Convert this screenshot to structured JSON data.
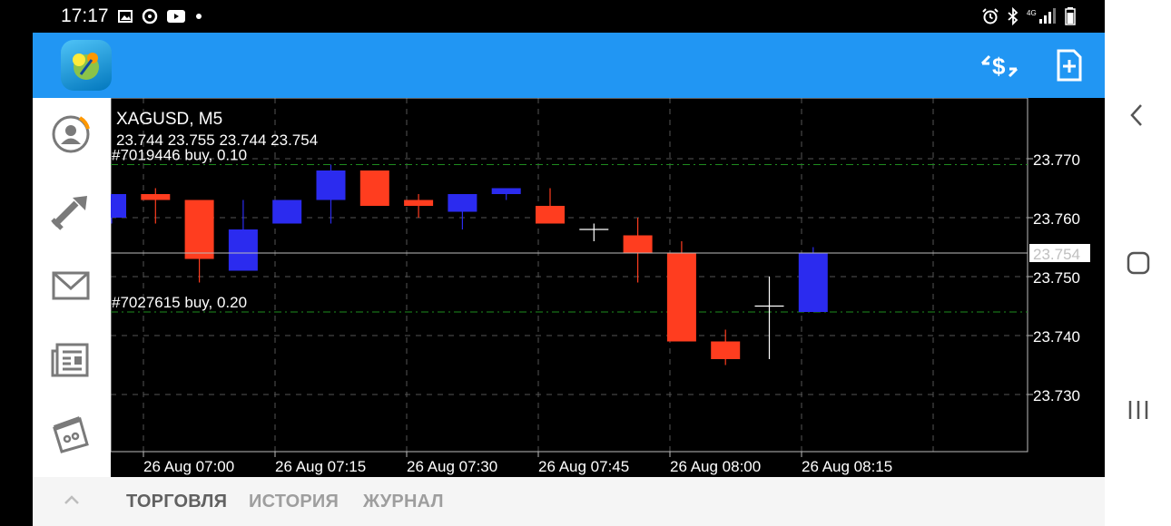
{
  "status": {
    "time": "17:17"
  },
  "chart": {
    "symbol": "XAGUSD, M5",
    "ohlc": "23.744 23.755 23.744 23.754",
    "orders": [
      {
        "label": "#7019446 buy, 0.10",
        "price": 23.769
      },
      {
        "label": "#7027615 buy, 0.20",
        "price": 23.744
      }
    ],
    "bid": 23.754,
    "bid_label": "23.754",
    "y_ticks": [
      "23.770",
      "23.760",
      "23.750",
      "23.740",
      "23.730"
    ],
    "x_ticks": [
      "26 Aug 07:00",
      "26 Aug 07:15",
      "26 Aug 07:30",
      "26 Aug 07:45",
      "26 Aug 08:00",
      "26 Aug 08:15"
    ],
    "colors": {
      "up": "#2b2bef",
      "down": "#ff3d1f",
      "doji": "#ffffff",
      "grid": "#555555"
    }
  },
  "chart_data": {
    "type": "candlestick",
    "y_ticks": [
      23.77,
      23.76,
      23.75,
      23.74,
      23.73
    ],
    "candles": [
      {
        "time": "06:50",
        "open": 23.76,
        "high": 23.764,
        "low": 23.759,
        "close": 23.764
      },
      {
        "time": "06:55",
        "open": 23.764,
        "high": 23.765,
        "low": 23.759,
        "close": 23.763
      },
      {
        "time": "07:00",
        "open": 23.763,
        "high": 23.763,
        "low": 23.749,
        "close": 23.753
      },
      {
        "time": "07:05",
        "open": 23.751,
        "high": 23.763,
        "low": 23.751,
        "close": 23.758
      },
      {
        "time": "07:10",
        "open": 23.759,
        "high": 23.763,
        "low": 23.759,
        "close": 23.763
      },
      {
        "time": "07:15",
        "open": 23.763,
        "high": 23.769,
        "low": 23.759,
        "close": 23.768
      },
      {
        "time": "07:20",
        "open": 23.768,
        "high": 23.768,
        "low": 23.762,
        "close": 23.762
      },
      {
        "time": "07:25",
        "open": 23.763,
        "high": 23.764,
        "low": 23.76,
        "close": 23.762
      },
      {
        "time": "07:30",
        "open": 23.761,
        "high": 23.764,
        "low": 23.758,
        "close": 23.764
      },
      {
        "time": "07:35",
        "open": 23.764,
        "high": 23.765,
        "low": 23.763,
        "close": 23.765
      },
      {
        "time": "07:40",
        "open": 23.762,
        "high": 23.765,
        "low": 23.759,
        "close": 23.759
      },
      {
        "time": "07:45",
        "open": 23.758,
        "high": 23.759,
        "low": 23.756,
        "close": 23.758
      },
      {
        "time": "07:50",
        "open": 23.757,
        "high": 23.76,
        "low": 23.749,
        "close": 23.754
      },
      {
        "time": "07:55",
        "open": 23.754,
        "high": 23.756,
        "low": 23.739,
        "close": 23.739
      },
      {
        "time": "08:00",
        "open": 23.739,
        "high": 23.741,
        "low": 23.735,
        "close": 23.736
      },
      {
        "time": "08:05",
        "open": 23.745,
        "high": 23.75,
        "low": 23.736,
        "close": 23.745
      },
      {
        "time": "08:10",
        "open": 23.744,
        "high": 23.755,
        "low": 23.744,
        "close": 23.754
      }
    ]
  },
  "tabs": [
    {
      "label": "ТОРГОВЛЯ",
      "active": true
    },
    {
      "label": "ИСТОРИЯ",
      "active": false
    },
    {
      "label": "ЖУРНАЛ",
      "active": false
    }
  ],
  "icons": {
    "status_left": [
      "gallery-icon",
      "media-icon",
      "youtube-icon",
      "dot-icon"
    ],
    "status_right": [
      "alarm-icon",
      "bluetooth-icon",
      "signal-icon",
      "battery-icon"
    ],
    "appbar": [
      "currency-exchange-icon",
      "new-order-icon"
    ],
    "sidebar": [
      "account-icon",
      "trade-icon",
      "mail-icon",
      "news-icon",
      "calendar-icon"
    ],
    "system_nav": [
      "back-icon",
      "home-icon",
      "recents-icon"
    ]
  }
}
